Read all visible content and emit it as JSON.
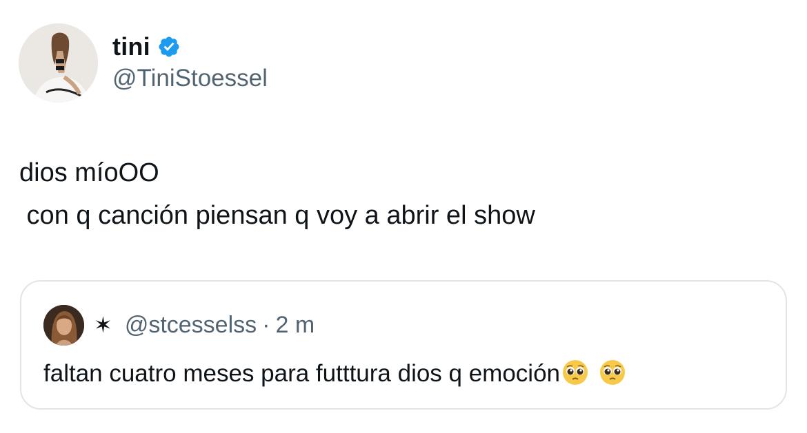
{
  "author": {
    "display_name": "tini",
    "handle": "@TiniStoessel",
    "verified_icon": "verified-badge-icon",
    "verified_color": "#1d9bf0"
  },
  "tweet": {
    "text_line1": "dios míoOO",
    "text_line2": " con q canción piensan q voy a abrir el show"
  },
  "quote": {
    "display_name": "✶",
    "handle": "@stcesselss",
    "separator": "·",
    "time": "2 m",
    "text": "faltan cuatro meses para futttura dios q emoción",
    "emojis": [
      "pleading-face-emoji",
      "pleading-face-emoji"
    ]
  },
  "colors": {
    "text": "#0f1419",
    "secondary": "#536471",
    "border": "#e1e5e8"
  }
}
